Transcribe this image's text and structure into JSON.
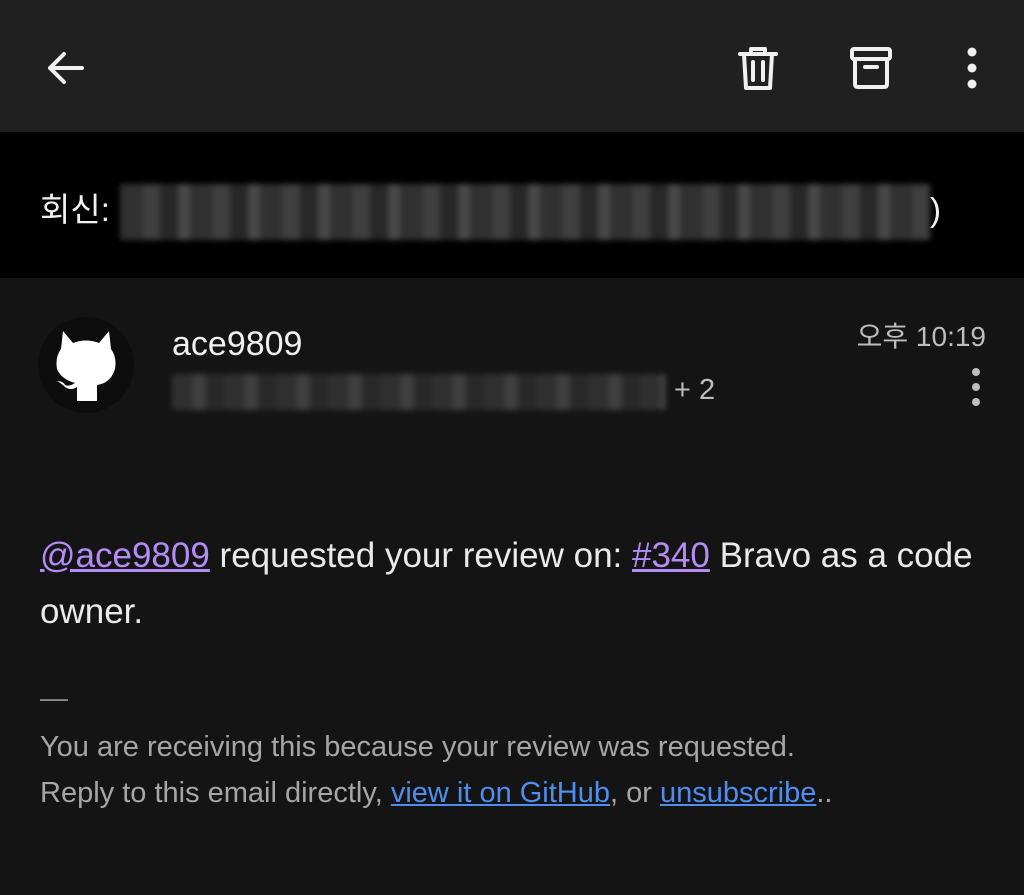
{
  "toolbar": {
    "back_icon": "arrow-left-icon",
    "delete_icon": "trash-icon",
    "archive_icon": "archive-icon",
    "more_icon": "more-vertical-icon"
  },
  "subject": {
    "prefix": "회신:",
    "suffix": ")"
  },
  "message": {
    "sender_name": "ace9809",
    "avatar_icon": "github-octocat-icon",
    "recipients_extra": "+ 2",
    "time": "오후 10:19",
    "body": {
      "mention": "@ace9809",
      "text_before_pr": " requested your review on: ",
      "pr_link": "#340",
      "text_after_pr": " Bravo as a code owner."
    },
    "footer": {
      "dash": "—",
      "line1": "You are receiving this because your review was requested.",
      "line2_start": "Reply to this email directly, ",
      "view_link": "view it on GitHub",
      "separator": ", or ",
      "unsubscribe_link": "unsubscribe",
      "end": ".."
    }
  },
  "colors": {
    "topbar": "#202020",
    "subject_bar": "#000000",
    "background": "#141414",
    "link_purple": "#b58cf6",
    "link_blue": "#4f8ef0"
  }
}
